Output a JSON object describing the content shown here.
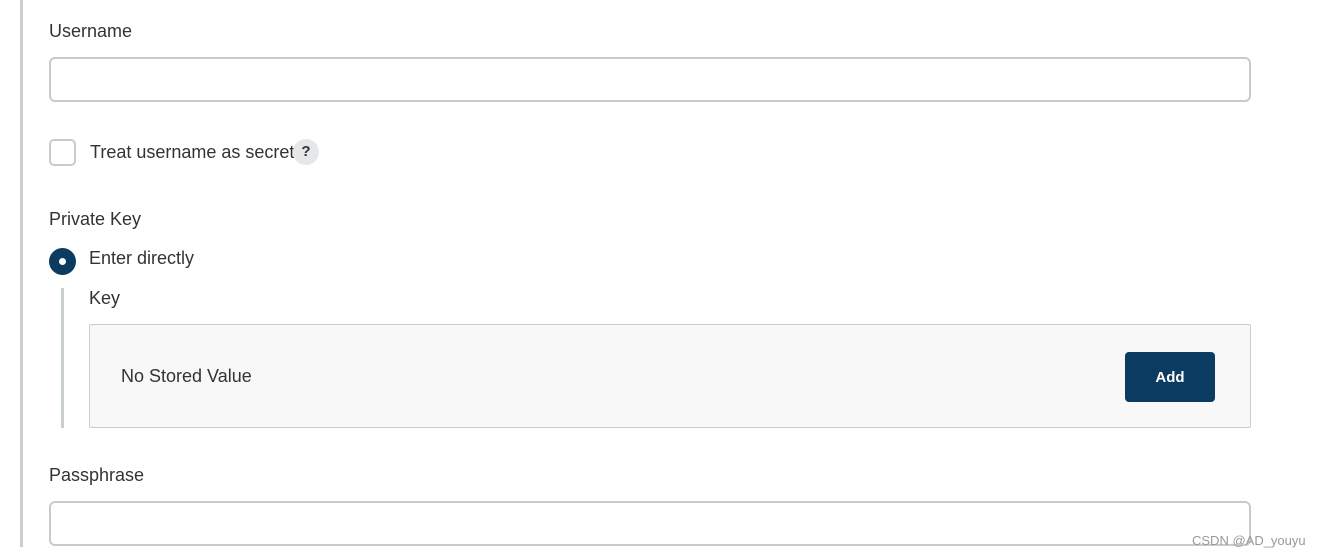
{
  "username": {
    "label": "Username",
    "value": "",
    "placeholder": ""
  },
  "treat_secret": {
    "label": "Treat username as secret",
    "checked": false,
    "help_icon": "question-mark-icon",
    "help_text": "?"
  },
  "private_key": {
    "label": "Private Key",
    "option_label": "Enter directly",
    "option_selected": true,
    "key": {
      "label": "Key",
      "status_text": "No Stored Value",
      "add_label": "Add"
    }
  },
  "passphrase": {
    "label": "Passphrase",
    "value": "",
    "placeholder": ""
  },
  "watermark": "CSDN @AD_youyu",
  "colors": {
    "accent": "#0b3b60",
    "border": "#c5cbd0",
    "box_bg": "#f8f8f8",
    "help_bg": "#e6e7e8"
  }
}
